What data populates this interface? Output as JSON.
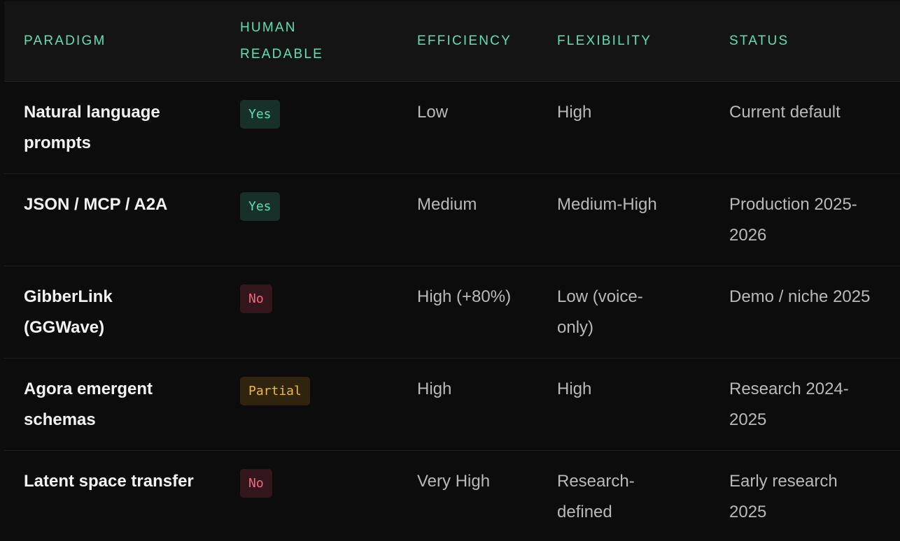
{
  "columns": [
    "PARADIGM",
    "HUMAN READABLE",
    "EFFICIENCY",
    "FLEXIBILITY",
    "STATUS"
  ],
  "rows": [
    {
      "paradigm": "Natural language prompts",
      "human_readable": "Yes",
      "readable_kind": "yes",
      "efficiency": "Low",
      "flexibility": "High",
      "status": "Current default"
    },
    {
      "paradigm": "JSON / MCP / A2A",
      "human_readable": "Yes",
      "readable_kind": "yes",
      "efficiency": "Medium",
      "flexibility": "Medium-High",
      "status": "Production 2025-2026"
    },
    {
      "paradigm": "GibberLink (GGWave)",
      "human_readable": "No",
      "readable_kind": "no",
      "efficiency": "High (+80%)",
      "flexibility": "Low (voice-only)",
      "status": "Demo / niche 2025"
    },
    {
      "paradigm": "Agora emergent schemas",
      "human_readable": "Partial",
      "readable_kind": "partial",
      "efficiency": "High",
      "flexibility": "High",
      "status": "Research 2024-2025"
    },
    {
      "paradigm": "Latent space transfer",
      "human_readable": "No",
      "readable_kind": "no",
      "efficiency": "Very High",
      "flexibility": "Research-defined",
      "status": "Early research 2025"
    }
  ],
  "colors": {
    "header_text": "#5ee0b2",
    "yes_badge": "#17302a",
    "no_badge": "#33161c",
    "partial_badge": "#30240f"
  }
}
